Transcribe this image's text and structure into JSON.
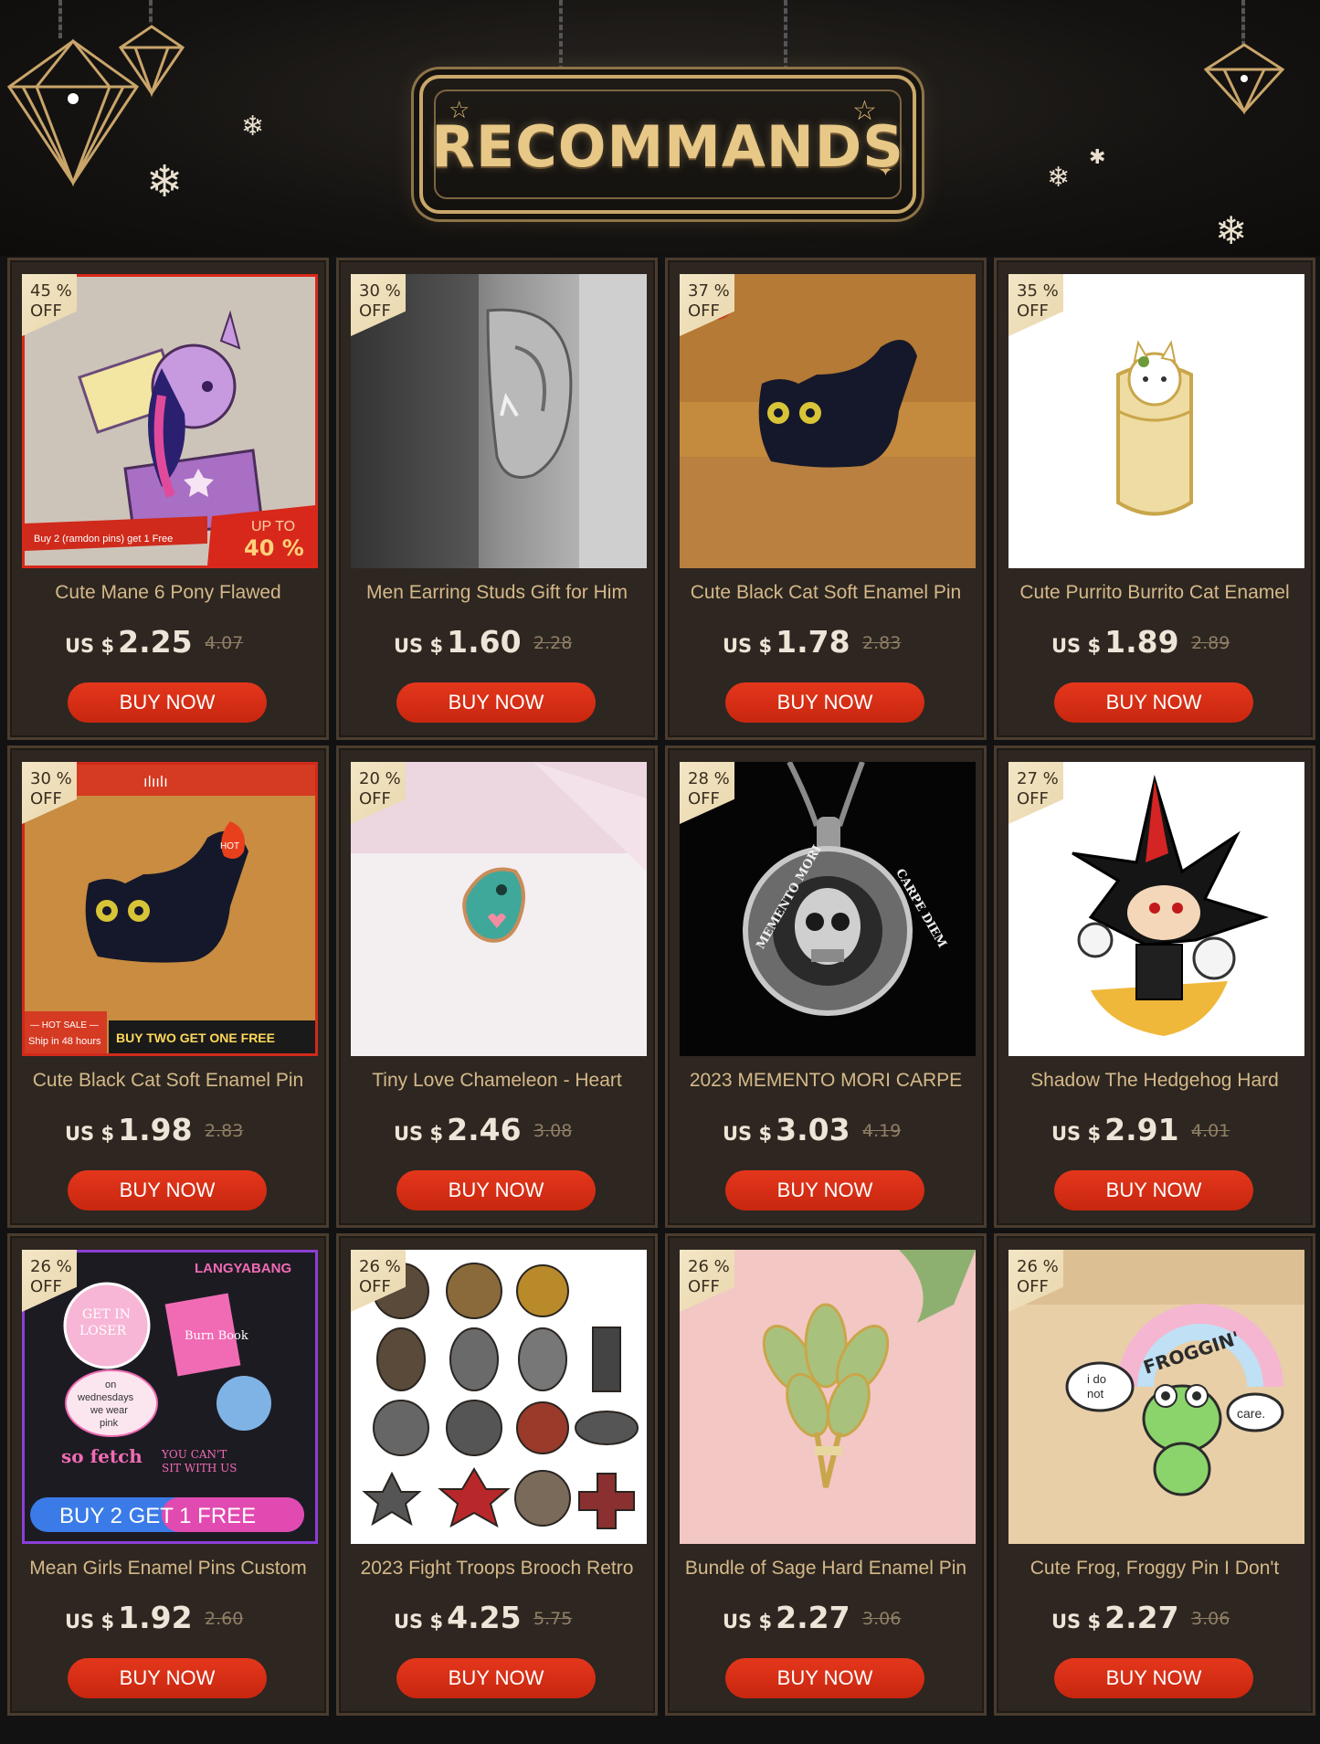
{
  "header": {
    "title": "RECOMMANDS"
  },
  "products": [
    {
      "discount_pct": "45 %",
      "off": "OFF",
      "title": "Cute Mane 6 Pony Flawed",
      "currency": "US $",
      "price": "2.25",
      "old_price": "4.07",
      "button": "BUY NOW",
      "overlay": {
        "promo": "Buy 2 (ramdon pins) get 1 Free",
        "upto": "UP TO",
        "upto_pct": "40 %"
      }
    },
    {
      "discount_pct": "30 %",
      "off": "OFF",
      "title": "Men Earring Studs Gift for Him",
      "currency": "US $",
      "price": "1.60",
      "old_price": "2.28",
      "button": "BUY NOW"
    },
    {
      "discount_pct": "37 %",
      "off": "OFF",
      "title": "Cute Black Cat Soft Enamel Pin",
      "currency": "US $",
      "price": "1.78",
      "old_price": "2.83",
      "button": "BUY NOW"
    },
    {
      "discount_pct": "35 %",
      "off": "OFF",
      "title": "Cute Purrito Burrito Cat Enamel",
      "currency": "US $",
      "price": "1.89",
      "old_price": "2.89",
      "button": "BUY NOW"
    },
    {
      "discount_pct": "30 %",
      "off": "OFF",
      "title": "Cute Black Cat Soft Enamel Pin",
      "currency": "US $",
      "price": "1.98",
      "old_price": "2.83",
      "button": "BUY NOW",
      "overlay": {
        "hot": "HOT",
        "hot_sale": "— HOT SALE —",
        "ship": "Ship in 48 hours",
        "buy_two": "BUY TWO GET ONE FREE"
      }
    },
    {
      "discount_pct": "20 %",
      "off": "OFF",
      "title": "Tiny Love Chameleon - Heart",
      "currency": "US $",
      "price": "2.46",
      "old_price": "3.08",
      "button": "BUY NOW"
    },
    {
      "discount_pct": "28 %",
      "off": "OFF",
      "title": "2023 MEMENTO MORI CARPE",
      "currency": "US $",
      "price": "3.03",
      "old_price": "4.19",
      "button": "BUY NOW",
      "overlay": {
        "ring_left": "MEMENTO MORI",
        "ring_right": "CARPE DIEM"
      }
    },
    {
      "discount_pct": "27 %",
      "off": "OFF",
      "title": "Shadow The Hedgehog Hard",
      "currency": "US $",
      "price": "2.91",
      "old_price": "4.01",
      "button": "BUY NOW"
    },
    {
      "discount_pct": "26 %",
      "off": "OFF",
      "title": "Mean Girls Enamel Pins Custom",
      "currency": "US $",
      "price": "1.92",
      "old_price": "2.60",
      "button": "BUY NOW",
      "overlay": {
        "brand": "LANGYABANG",
        "get_in": "GET IN",
        "loser": "LOSER",
        "burn": "Burn Book",
        "wed1": "on",
        "wed2": "wednesdays",
        "wed3": "we wear",
        "wed4": "pink",
        "fetch": "so fetch",
        "sit1": "YOU CAN'T",
        "sit2": "SIT WITH US",
        "banner": "BUY 2 GET 1 FREE"
      }
    },
    {
      "discount_pct": "26 %",
      "off": "OFF",
      "title": "2023 Fight Troops Brooch Retro",
      "currency": "US $",
      "price": "4.25",
      "old_price": "5.75",
      "button": "BUY NOW"
    },
    {
      "discount_pct": "26 %",
      "off": "OFF",
      "title": "Bundle of Sage Hard Enamel Pin",
      "currency": "US $",
      "price": "2.27",
      "old_price": "3.06",
      "button": "BUY NOW"
    },
    {
      "discount_pct": "26 %",
      "off": "OFF",
      "title": "Cute Frog, Froggy Pin I Don't",
      "currency": "US $",
      "price": "2.27",
      "old_price": "3.06",
      "button": "BUY NOW",
      "overlay": {
        "arc": "FROGGIN'",
        "cloud1": "i do",
        "cloud2": "not",
        "care": "care."
      }
    }
  ],
  "colors": {
    "accent_gold": "#e8c887",
    "button_red": "#d42e14",
    "card_bg": "#2e2620"
  }
}
